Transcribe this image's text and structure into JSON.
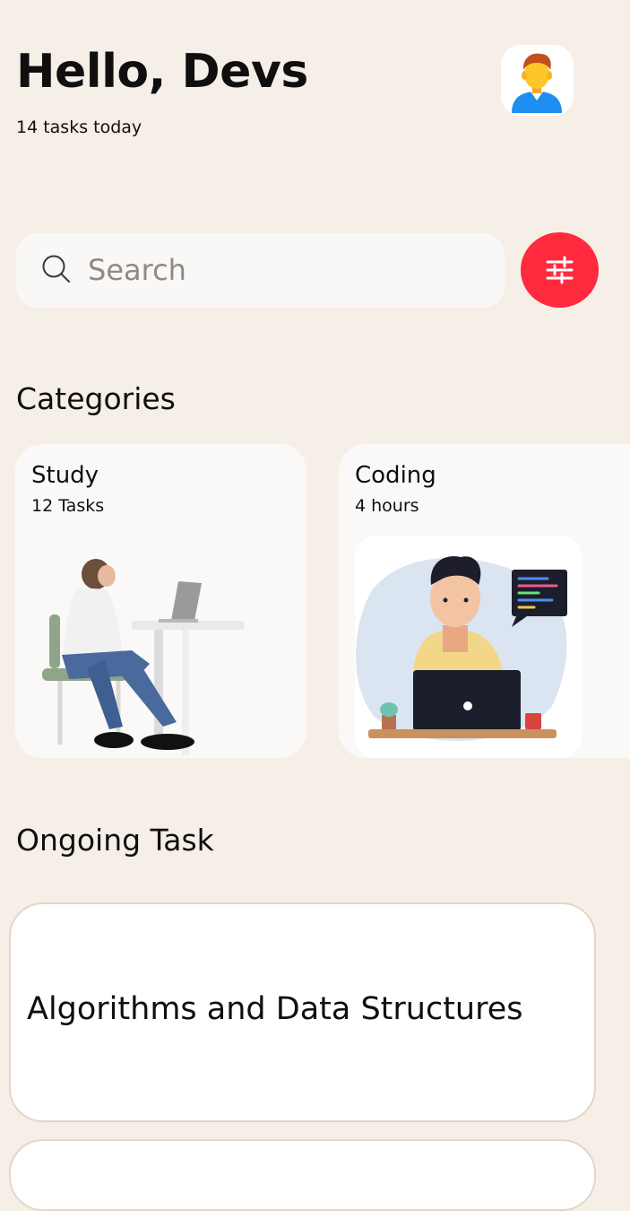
{
  "header": {
    "greeting": "Hello, Devs",
    "subtitle": "14 tasks today"
  },
  "search": {
    "placeholder": "Search",
    "value": ""
  },
  "categories": {
    "title": "Categories",
    "items": [
      {
        "title": "Study",
        "subtitle": "12 Tasks"
      },
      {
        "title": "Coding",
        "subtitle": "4 hours"
      }
    ]
  },
  "ongoing": {
    "title": "Ongoing Task",
    "tasks": [
      {
        "title": "Algorithms and Data Structures"
      },
      {
        "title": ""
      }
    ]
  },
  "colors": {
    "background": "#f6efe8",
    "accent": "#ff2a3d",
    "card": "#fbf9f8",
    "card_border": "#e6d5c4"
  },
  "icons": {
    "avatar": "user-avatar-icon",
    "search": "search-icon",
    "filter": "sliders-icon"
  }
}
